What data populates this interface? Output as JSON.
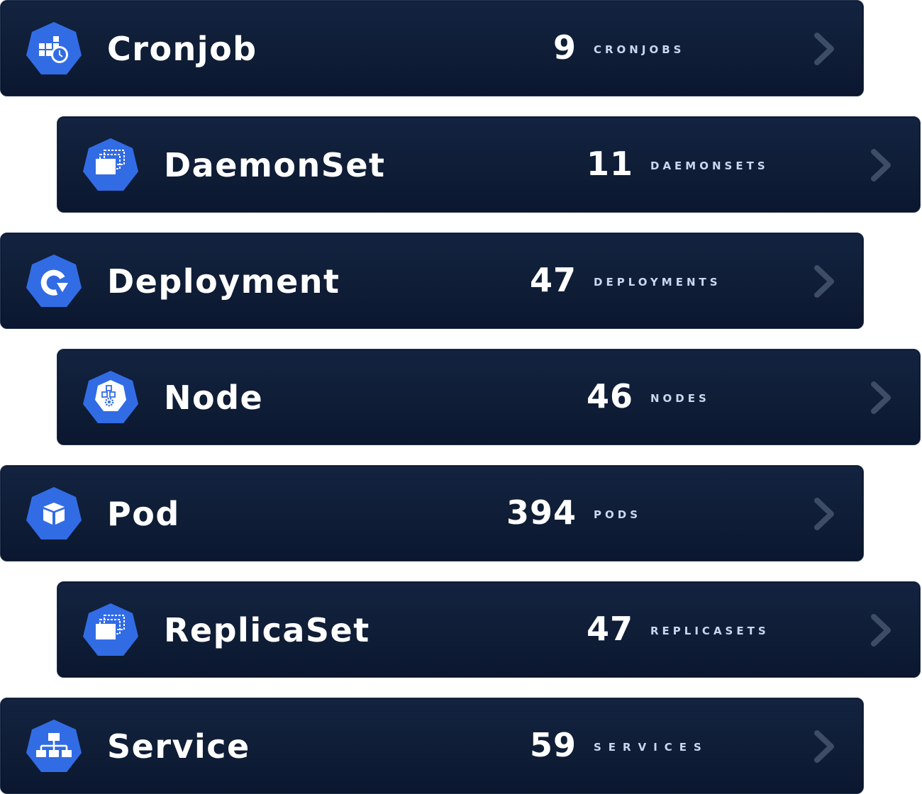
{
  "resources": [
    {
      "name": "Cronjob",
      "count": "9",
      "unit": "CRONJOBS",
      "icon": "cronjob-icon"
    },
    {
      "name": "DaemonSet",
      "count": "11",
      "unit": "DAEMONSETS",
      "icon": "daemonset-icon"
    },
    {
      "name": "Deployment",
      "count": "47",
      "unit": "DEPLOYMENTS",
      "icon": "deployment-icon"
    },
    {
      "name": "Node",
      "count": "46",
      "unit": "NODES",
      "icon": "node-icon"
    },
    {
      "name": "Pod",
      "count": "394",
      "unit": "PODS",
      "icon": "pod-icon"
    },
    {
      "name": "ReplicaSet",
      "count": "47",
      "unit": "REPLICASETS",
      "icon": "replicaset-icon"
    },
    {
      "name": "Service",
      "count": "59",
      "unit": "SERVICES",
      "icon": "service-icon"
    }
  ],
  "chevron_icon": "chevron-right-icon",
  "colors": {
    "card_background": "#0f1d36",
    "icon_blue": "#326ce5",
    "count_text": "#ffffff",
    "unit_text": "#c9d8ef",
    "chevron": "#3d4d66"
  }
}
